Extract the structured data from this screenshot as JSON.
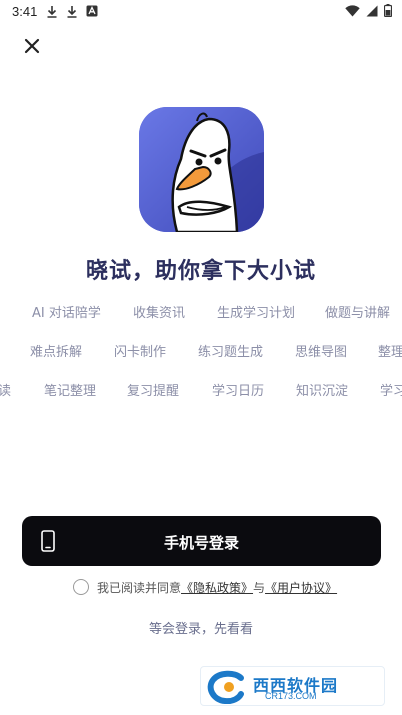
{
  "status_bar": {
    "time": "3:41",
    "left_icons": [
      "download-icon",
      "download-icon",
      "notification-app-icon"
    ],
    "right_icons": [
      "wifi-icon",
      "signal-icon",
      "battery-icon"
    ]
  },
  "close_icon": "close-icon",
  "logo": {
    "name": "app-logo",
    "accent": "#5a67d8"
  },
  "headline": "晓试，助你拿下大小试",
  "tag_rows": [
    [
      "AI 对话陪学",
      "收集资讯",
      "生成学习计划",
      "做题与讲解"
    ],
    [
      "难点拆解",
      "闪卡制作",
      "练习题生成",
      "思维导图",
      "整理"
    ],
    [
      "读",
      "笔记整理",
      "复习提醒",
      "学习日历",
      "知识沉淀",
      "学习"
    ]
  ],
  "login": {
    "phone_button_label": "手机号登录",
    "agree_prefix": "我已阅读并同意",
    "privacy_link": "《隐私政策》",
    "and_text": "与",
    "terms_link": "《用户协议》",
    "later_link": "等会登录，先看看"
  },
  "watermark": {
    "brand": "西西软件园",
    "url": "CR173.COM"
  },
  "colors": {
    "primary_button": "#0b0b0f",
    "headline": "#2c2f5e",
    "tag_text": "#8c8fa8"
  }
}
